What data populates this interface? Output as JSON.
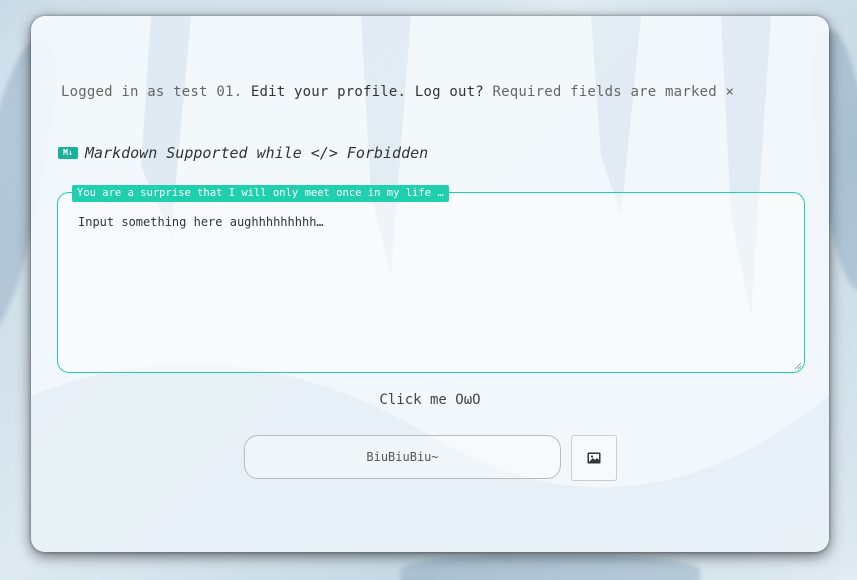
{
  "header": {
    "logged_prefix": "Logged in as test 01.",
    "edit_profile": "Edit your profile.",
    "log_out": "Log out?",
    "required_note": "Required fields are marked ×"
  },
  "markdown": {
    "icon_text": "M↓",
    "note": "Markdown Supported while </> Forbidden"
  },
  "comment": {
    "label": "You are a surprise that I will only meet once in my life …",
    "placeholder": "Input something here aughhhhhhhhh…"
  },
  "actions": {
    "click_me": "Click me OωO",
    "submit_label": "BiuBiuBiu~",
    "image_icon": "image-icon"
  },
  "colors": {
    "accent": "#1fcfad"
  }
}
